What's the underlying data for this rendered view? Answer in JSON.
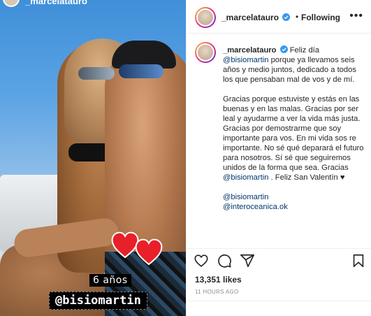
{
  "post": {
    "author": "_marcelatauro",
    "follow_label": "Following",
    "separator": "•",
    "more": "•••",
    "verified": true
  },
  "photo_overlay": {
    "top_username": "_marcelatauro",
    "years_sticker": "6 años",
    "handle_sticker": "@bisiomartin"
  },
  "caption": {
    "username": "_marcelatauro",
    "p1_text_a": "Feliz día",
    "p1_mention": "@bisiomartin",
    "p1_text_b": "porque ya llevamos seis años y medio juntos, dedicado a todos los que pensaban mal de vos y de mí.",
    "p2_text_a": "Gracias porque estuviste y estás en las buenas y en las malas. Gracias por ser leal y ayudarme a ver la vida más justa. Gracias por demostrarme que soy importante para vos. En mi vida sos re importante. No sé qué deparará el futuro para nosotros. Sí sé que seguiremos unidos de la forma que sea. Gracias",
    "p2_mention": "@bisiomartin",
    "p2_text_b": ". Feliz San Valentín ♥",
    "link1": "@bisiomartin",
    "link2": "@interoceanica.ok"
  },
  "stats": {
    "likes": "13,351 likes",
    "timestamp": "11 HOURS AGO"
  },
  "icons": [
    "verified-badge-icon",
    "heart-icon",
    "comment-icon",
    "share-icon",
    "bookmark-icon",
    "more-icon"
  ],
  "colors": {
    "mention": "#00376b",
    "verified": "#3897f0",
    "sticker_heart": "#e8202a"
  }
}
